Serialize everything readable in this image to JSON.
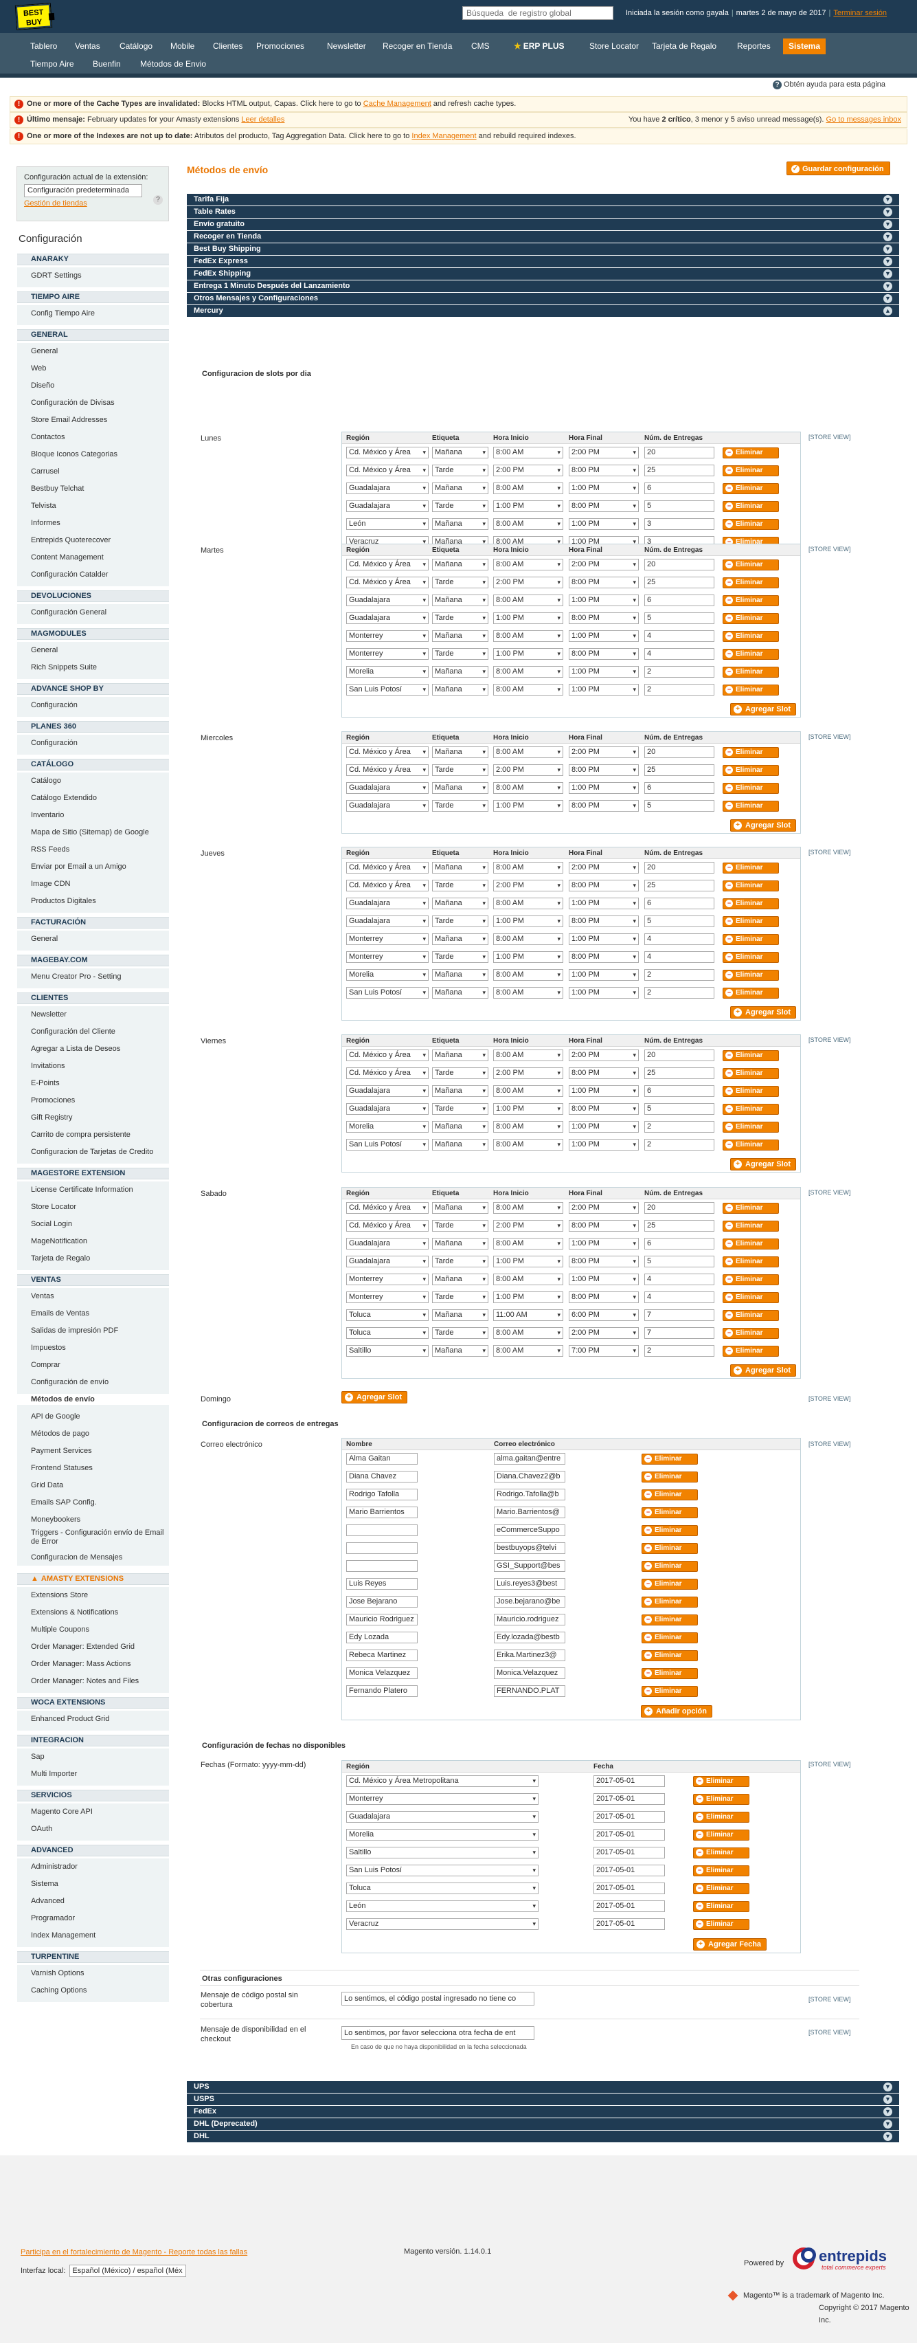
{
  "header": {
    "logo": "BEST BUY",
    "search_placeholder": "Búsqueda  de registro global",
    "session_user": "Iniciada la sesión como gayala",
    "date": "martes 2 de mayo de 2017",
    "logout": "Terminar sesión"
  },
  "nav": {
    "row1": [
      "Tablero",
      "Ventas",
      "Catálogo",
      "Mobile",
      "Clientes",
      "Promociones",
      "Newsletter",
      "Recoger en Tienda",
      "CMS",
      "ERP PLUS",
      "Store Locator",
      "Tarjeta de Regalo",
      "Reportes",
      "Sistema"
    ],
    "row2": [
      "Tiempo Aire",
      "Buenfin",
      "Métodos de Envio"
    ],
    "help": "Obtén ayuda para esta página"
  },
  "messages": [
    {
      "bold": "One or more of the Cache Types are invalidated:",
      "text": " Blocks HTML output, Capas. Click here to go to ",
      "link": "Cache Management",
      "after": " and refresh cache types.",
      "right_pre": "",
      "right_bold": "",
      "right_mid": "",
      "right_link": ""
    },
    {
      "bold": "Último mensaje:",
      "text": " February updates for your Amasty extensions ",
      "link": "Leer detalles",
      "after": "",
      "right_pre": "You have ",
      "right_bold": "2 crítico",
      "right_mid": ", 3 menor y 5 aviso unread message(s). ",
      "right_link": "Go to messages inbox"
    },
    {
      "bold": "One or more of the Indexes are not up to date:",
      "text": " Atributos del producto, Tag Aggregation Data. Click here to go to ",
      "link": "Index Management",
      "after": " and rebuild required indexes.",
      "right_pre": "",
      "right_bold": "",
      "right_mid": "",
      "right_link": ""
    }
  ],
  "sidebar": {
    "scope_label": "Configuración actual de la extensión:",
    "scope_value": "Configuración predeterminada",
    "scope_link": "Gestión de tiendas",
    "title": "Configuración",
    "sections": [
      {
        "title": "ANARAKY",
        "items": [
          "GDRT Settings"
        ]
      },
      {
        "title": "TIEMPO AIRE",
        "items": [
          "Config Tiempo Aire"
        ]
      },
      {
        "title": "GENERAL",
        "items": [
          "General",
          "Web",
          "Diseño",
          "Configuración de Divisas",
          "Store Email Addresses",
          "Contactos",
          "Bloque Iconos Categorias",
          "Carrusel",
          "Bestbuy Telchat",
          "Telvista",
          "Informes",
          "Entrepids Quoterecover",
          "Content Management",
          "Configuración Catalder"
        ]
      },
      {
        "title": "DEVOLUCIONES",
        "items": [
          "Configuración General"
        ]
      },
      {
        "title": "MAGMODULES",
        "items": [
          "General",
          "Rich Snippets Suite"
        ]
      },
      {
        "title": "ADVANCE SHOP BY",
        "items": [
          "Configuración"
        ]
      },
      {
        "title": "PLANES 360",
        "items": [
          "Configuración"
        ]
      },
      {
        "title": "CATÁLOGO",
        "items": [
          "Catálogo",
          "Catálogo Extendido",
          "Inventario",
          "Mapa de Sitio (Sitemap) de Google",
          "RSS Feeds",
          "Enviar por Email a un Amigo",
          "Image CDN",
          "Productos Digitales"
        ]
      },
      {
        "title": "FACTURACIÓN",
        "items": [
          "General"
        ]
      },
      {
        "title": "MAGEBAY.COM",
        "items": [
          "Menu Creator Pro - Setting"
        ]
      },
      {
        "title": "CLIENTES",
        "items": [
          "Newsletter",
          "Configuración del Cliente",
          "Agregar a Lista de Deseos",
          "Invitations",
          "E-Points",
          "Promociones",
          "Gift Registry",
          "Carrito de compra persistente",
          "Configuracion de Tarjetas de Credito"
        ]
      },
      {
        "title": "MAGESTORE EXTENSION",
        "items": [
          "License Certificate Information",
          "Store Locator",
          "Social Login",
          "MageNotification",
          "Tarjeta de Regalo"
        ]
      },
      {
        "title": "VENTAS",
        "items": [
          "Ventas",
          "Emails de Ventas",
          "Salidas de impresión PDF",
          "Impuestos",
          "Comprar",
          "Configuración de envío",
          "Métodos de envío",
          "API de Google",
          "Métodos de pago",
          "Payment Services",
          "Frontend Statuses",
          "Grid Data",
          "Emails SAP Config.",
          "Moneybookers",
          "Triggers - Configuración envío de Email de Error",
          "Configuracion de Mensajes"
        ]
      },
      {
        "title": "AMASTY EXTENSIONS",
        "items": [
          "Extensions Store",
          "Extensions & Notifications",
          "Multiple Coupons",
          "Order Manager: Extended Grid",
          "Order Manager: Mass Actions",
          "Order Manager: Notes and Files"
        ]
      },
      {
        "title": "WOCA EXTENSIONS",
        "items": [
          "Enhanced Product Grid"
        ]
      },
      {
        "title": "INTEGRACION",
        "items": [
          "Sap",
          "Multi Importer"
        ]
      },
      {
        "title": "SERVICIOS",
        "items": [
          "Magento Core API",
          "OAuth"
        ]
      },
      {
        "title": "ADVANCED",
        "items": [
          "Administrador",
          "Sistema",
          "Advanced",
          "Programador",
          "Index Management"
        ]
      },
      {
        "title": "TURPENTINE",
        "items": [
          "Varnish Options",
          "Caching Options"
        ]
      }
    ]
  },
  "content": {
    "page_title": "Métodos de envío",
    "save_button": "Guardar configuración",
    "sections_top": [
      "Tarifa Fija",
      "Table Rates",
      "Envío gratuito",
      "Recoger en Tienda",
      "Best Buy Shipping",
      "FedEx Express",
      "FedEx Shipping",
      "Entrega 1 Minuto Después del Lanzamiento",
      "Otros Mensajes y Configuraciones",
      "Mercury"
    ],
    "slots_title": "Configuracion de slots por dia",
    "col_headers": [
      "Región",
      "Etiqueta",
      "Hora Inicio",
      "Hora Final",
      "Núm. de Entregas"
    ],
    "delete_label": "Eliminar",
    "add_slot_label": "Agregar Slot",
    "store_view": "[STORE VIEW]",
    "days": [
      {
        "name": "Lunes",
        "rows": [
          [
            "Cd. México y Área",
            "Mañana",
            "8:00 AM",
            "2:00 PM",
            "20"
          ],
          [
            "Cd. México y Área",
            "Tarde",
            "2:00 PM",
            "8:00 PM",
            "25"
          ],
          [
            "Guadalajara",
            "Mañana",
            "8:00 AM",
            "1:00 PM",
            "6"
          ],
          [
            "Guadalajara",
            "Tarde",
            "1:00 PM",
            "8:00 PM",
            "5"
          ],
          [
            "León",
            "Mañana",
            "8:00 AM",
            "1:00 PM",
            "3"
          ],
          [
            "Veracruz",
            "Mañana",
            "8:00 AM",
            "1:00 PM",
            "3"
          ]
        ]
      },
      {
        "name": "Martes",
        "rows": [
          [
            "Cd. México y Área",
            "Mañana",
            "8:00 AM",
            "2:00 PM",
            "20"
          ],
          [
            "Cd. México y Área",
            "Tarde",
            "2:00 PM",
            "8:00 PM",
            "25"
          ],
          [
            "Guadalajara",
            "Mañana",
            "8:00 AM",
            "1:00 PM",
            "6"
          ],
          [
            "Guadalajara",
            "Tarde",
            "1:00 PM",
            "8:00 PM",
            "5"
          ],
          [
            "Monterrey",
            "Mañana",
            "8:00 AM",
            "1:00 PM",
            "4"
          ],
          [
            "Monterrey",
            "Tarde",
            "1:00 PM",
            "8:00 PM",
            "4"
          ],
          [
            "Morelia",
            "Mañana",
            "8:00 AM",
            "1:00 PM",
            "2"
          ],
          [
            "San Luis Potosí",
            "Mañana",
            "8:00 AM",
            "1:00 PM",
            "2"
          ]
        ]
      },
      {
        "name": "Miercoles",
        "rows": [
          [
            "Cd. México y Área",
            "Mañana",
            "8:00 AM",
            "2:00 PM",
            "20"
          ],
          [
            "Cd. México y Área",
            "Tarde",
            "2:00 PM",
            "8:00 PM",
            "25"
          ],
          [
            "Guadalajara",
            "Mañana",
            "8:00 AM",
            "1:00 PM",
            "6"
          ],
          [
            "Guadalajara",
            "Tarde",
            "1:00 PM",
            "8:00 PM",
            "5"
          ]
        ]
      },
      {
        "name": "Jueves",
        "rows": [
          [
            "Cd. México y Área",
            "Mañana",
            "8:00 AM",
            "2:00 PM",
            "20"
          ],
          [
            "Cd. México y Área",
            "Tarde",
            "2:00 PM",
            "8:00 PM",
            "25"
          ],
          [
            "Guadalajara",
            "Mañana",
            "8:00 AM",
            "1:00 PM",
            "6"
          ],
          [
            "Guadalajara",
            "Tarde",
            "1:00 PM",
            "8:00 PM",
            "5"
          ],
          [
            "Monterrey",
            "Mañana",
            "8:00 AM",
            "1:00 PM",
            "4"
          ],
          [
            "Monterrey",
            "Tarde",
            "1:00 PM",
            "8:00 PM",
            "4"
          ],
          [
            "Morelia",
            "Mañana",
            "8:00 AM",
            "1:00 PM",
            "2"
          ],
          [
            "San Luis Potosí",
            "Mañana",
            "8:00 AM",
            "1:00 PM",
            "2"
          ]
        ]
      },
      {
        "name": "Viernes",
        "rows": [
          [
            "Cd. México y Área",
            "Mañana",
            "8:00 AM",
            "2:00 PM",
            "20"
          ],
          [
            "Cd. México y Área",
            "Tarde",
            "2:00 PM",
            "8:00 PM",
            "25"
          ],
          [
            "Guadalajara",
            "Mañana",
            "8:00 AM",
            "1:00 PM",
            "6"
          ],
          [
            "Guadalajara",
            "Tarde",
            "1:00 PM",
            "8:00 PM",
            "5"
          ],
          [
            "Morelia",
            "Mañana",
            "8:00 AM",
            "1:00 PM",
            "2"
          ],
          [
            "San Luis Potosí",
            "Mañana",
            "8:00 AM",
            "1:00 PM",
            "2"
          ]
        ]
      },
      {
        "name": "Sabado",
        "rows": [
          [
            "Cd. México y Área",
            "Mañana",
            "8:00 AM",
            "2:00 PM",
            "20"
          ],
          [
            "Cd. México y Área",
            "Tarde",
            "2:00 PM",
            "8:00 PM",
            "25"
          ],
          [
            "Guadalajara",
            "Mañana",
            "8:00 AM",
            "1:00 PM",
            "6"
          ],
          [
            "Guadalajara",
            "Tarde",
            "1:00 PM",
            "8:00 PM",
            "5"
          ],
          [
            "Monterrey",
            "Mañana",
            "8:00 AM",
            "1:00 PM",
            "4"
          ],
          [
            "Monterrey",
            "Tarde",
            "1:00 PM",
            "8:00 PM",
            "4"
          ],
          [
            "Toluca",
            "Mañana",
            "11:00 AM",
            "6:00 PM",
            "7"
          ],
          [
            "Toluca",
            "Tarde",
            "8:00 AM",
            "2:00 PM",
            "7"
          ],
          [
            "Saltillo",
            "Mañana",
            "8:00 AM",
            "7:00 PM",
            "2"
          ]
        ]
      },
      {
        "name": "Domingo",
        "rows": []
      }
    ],
    "email_title": "Configuracion de correos de entregas",
    "email_label": "Correo electrónico",
    "email_headers": [
      "Nombre",
      "Correo electrónico"
    ],
    "email_rows": [
      [
        "Alma Gaitan",
        "alma.gaitan@entre"
      ],
      [
        "Diana Chavez",
        "Diana.Chavez2@b"
      ],
      [
        "Rodrigo Tafolla",
        "Rodrigo.Tafolla@b"
      ],
      [
        "Mario Barrientos",
        "Mario.Barrientos@"
      ],
      [
        "",
        "eCommerceSuppo"
      ],
      [
        "",
        "bestbuyops@telvi"
      ],
      [
        "",
        "GSI_Support@bes"
      ],
      [
        "Luis Reyes",
        "Luis.reyes3@best"
      ],
      [
        "Jose Bejarano",
        "Jose.bejarano@be"
      ],
      [
        "Mauricio Rodriguez",
        "Mauricio.rodriguez"
      ],
      [
        "Edy Lozada",
        "Edy.lozada@bestb"
      ],
      [
        "Rebeca Martinez",
        "Erika.Martinez3@"
      ],
      [
        "Monica Velazquez",
        "Monica.Velazquez"
      ],
      [
        "Fernando Platero",
        "FERNANDO.PLAT"
      ]
    ],
    "add_option_label": "Añadir opción",
    "dates_title": "Configuración de fechas no disponibles",
    "dates_label": "Fechas (Formato: yyyy-mm-dd)",
    "dates_headers": [
      "Región",
      "Fecha"
    ],
    "dates_rows": [
      [
        "Cd. México y Área Metropolitana",
        "2017-05-01"
      ],
      [
        "Monterrey",
        "2017-05-01"
      ],
      [
        "Guadalajara",
        "2017-05-01"
      ],
      [
        "Morelia",
        "2017-05-01"
      ],
      [
        "Saltillo",
        "2017-05-01"
      ],
      [
        "San Luis Potosí",
        "2017-05-01"
      ],
      [
        "Toluca",
        "2017-05-01"
      ],
      [
        "León",
        "2017-05-01"
      ],
      [
        "Veracruz",
        "2017-05-01"
      ]
    ],
    "add_date_label": "Agregar Fecha",
    "other_title": "Otras configuraciones",
    "other": [
      {
        "label": "Mensaje de código postal sin cobertura",
        "value": "Lo sentimos, el código postal ingresado no tiene co"
      },
      {
        "label": "Mensaje de disponibilidad en el checkout",
        "value": "Lo sentimos, por favor selecciona otra fecha de ent",
        "hint": "En caso de que no haya disponibilidad en la fecha seleccionada"
      }
    ],
    "sections_bottom": [
      "UPS",
      "USPS",
      "FedEx",
      "DHL (Deprecated)",
      "DHL"
    ]
  },
  "footer": {
    "help_link": "Participa en el fortalecimiento de Magento - Reporte todas las fallas",
    "locale_label": "Interfaz local:",
    "locale_value": "Español (México) / español (Méx",
    "version": "Magento versión. 1.14.0.1",
    "powered": "Powered by",
    "brand": "entrepids",
    "brand_tagline": "total commerce experts",
    "trademark": "Magento™ is a trademark of Magento Inc.",
    "copyright": "Copyright © 2017 Magento Inc."
  }
}
